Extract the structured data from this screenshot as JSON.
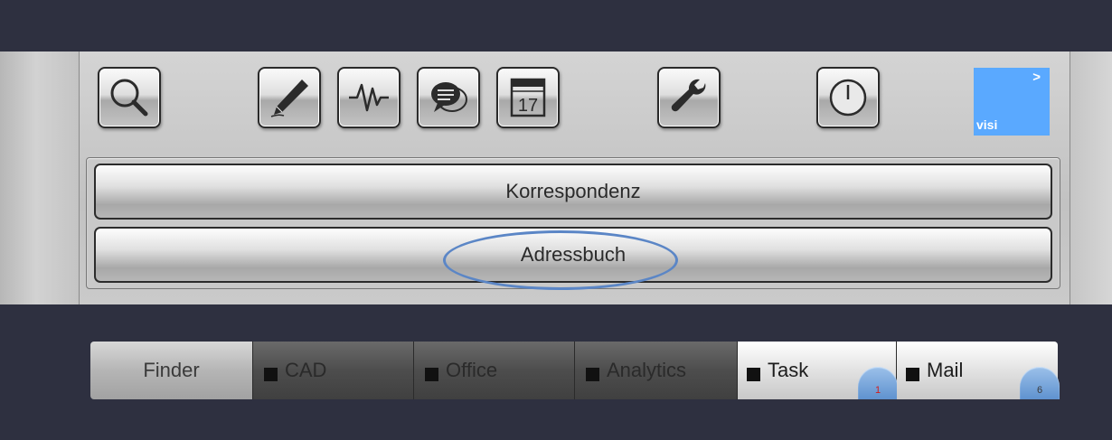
{
  "toolbar": {
    "icons": [
      "search-icon",
      "pen-icon",
      "pulse-icon",
      "chat-icon",
      "calendar-icon",
      "wrench-icon",
      "power-icon"
    ],
    "calendar_day": "17",
    "visi": {
      "arrow": ">",
      "label": "visi",
      "color": "#5aa9ff"
    }
  },
  "menu": {
    "items": [
      {
        "label": "Korrespondenz"
      },
      {
        "label": "Adressbuch",
        "highlighted": true
      }
    ],
    "highlight_color": "#5b86c6"
  },
  "tabs": [
    {
      "label": "Finder"
    },
    {
      "label": "CAD"
    },
    {
      "label": "Office"
    },
    {
      "label": "Analytics"
    },
    {
      "label": "Task",
      "badge": "1"
    },
    {
      "label": "Mail",
      "badge": "6"
    }
  ],
  "colors": {
    "background": "#2e3040",
    "badge": "#6b9bd6",
    "badge_alert_text": "#d21d1d"
  }
}
